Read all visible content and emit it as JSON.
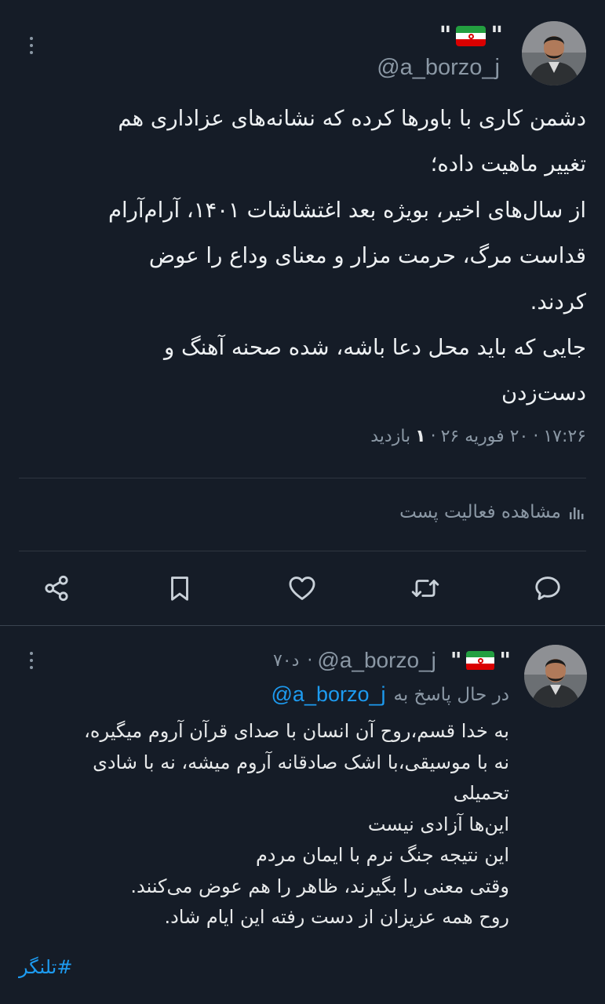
{
  "main_tweet": {
    "display_name_quote_open": "\"",
    "display_name_quote_close": "\"",
    "flag": "iran-flag",
    "handle": "@a_borzo_j",
    "text": "دشمن کاری با باورها کرده که نشانه‌های عزاداری هم\nتغییر ماهیت داده؛\nاز سال‌های اخیر، بویژه بعد اغتشاشات ۱۴۰۱، آرام‌آرام\nقداست مرگ، حرمت مزار و معنای وداع را عوض\nکردند.\nجایی که باید محل دعا باشه، شده صحنه آهنگ و\nدست‌زدن",
    "time": "۱۷:۲۶",
    "separator_dot": "·",
    "date": "۲۰ فوریه ۲۶",
    "views_count": "۱",
    "views_label": "بازدید",
    "activity_label": "مشاهده فعالیت پست",
    "actions": [
      "share-icon",
      "bookmark-icon",
      "like-icon",
      "retweet-icon",
      "reply-icon"
    ]
  },
  "reply_tweet": {
    "display_name_quote_open": "\"",
    "display_name_quote_close": "\"",
    "flag": "iran-flag",
    "handle": "@a_borzo_j",
    "separator_dot": "·",
    "time_ago": "۷۰د",
    "replying_label": "در حال پاسخ به",
    "replying_to": "@a_borzo_j",
    "text": "به خدا قسم،روح آن انسان با صدای قرآن آروم میگیره،\nنه با موسیقی،با اشک صادقانه آروم میشه، نه با شادی\nتحمیلی\nاین‌ها آزادی نیست\nاین نتیجه جنگ نرم با ایمان مردم\nوقتی معنی را بگیرند، ظاهر را هم عوض می‌کنند.\nروح همه عزیزان از دست رفته این ایام شاد.",
    "hashtag": "#تلنگر"
  },
  "colors": {
    "background": "#151c27",
    "text": "#e7e9ea",
    "muted": "#8b98a5",
    "link": "#1d9bf0",
    "divider": "#2f3640"
  }
}
